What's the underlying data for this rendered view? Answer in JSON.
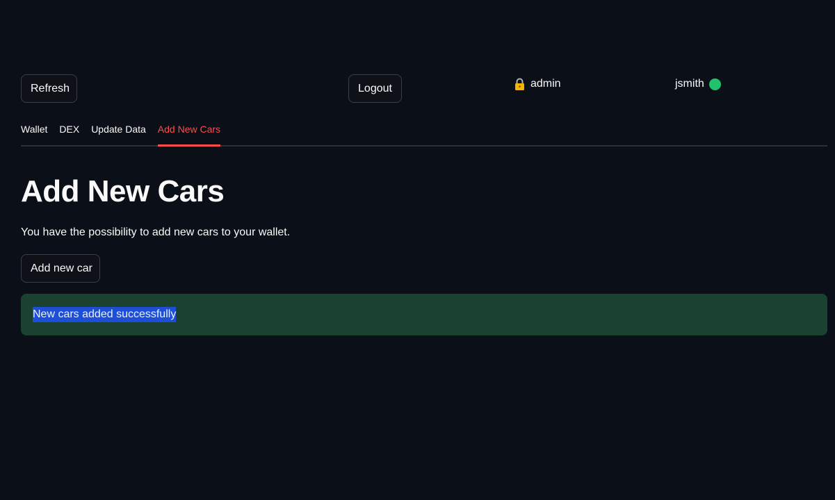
{
  "header": {
    "refresh_label": "Refresh",
    "logout_label": "Logout",
    "role_label": "admin",
    "username": "jsmith",
    "status_color": "#21c26b",
    "lock_icon": "lock-icon"
  },
  "tabs": [
    {
      "label": "Wallet",
      "active": false
    },
    {
      "label": "DEX",
      "active": false
    },
    {
      "label": "Update Data",
      "active": false
    },
    {
      "label": "Add New Cars",
      "active": true
    }
  ],
  "main": {
    "title": "Add New Cars",
    "description": "You have the possibility to add new cars to your wallet.",
    "add_car_label": "Add new car",
    "success_message": "New cars added successfully"
  },
  "colors": {
    "accent": "#ff4b4b",
    "success_bg": "#1b4230",
    "selection": "#1d4ed8",
    "background": "#0b0f17"
  }
}
